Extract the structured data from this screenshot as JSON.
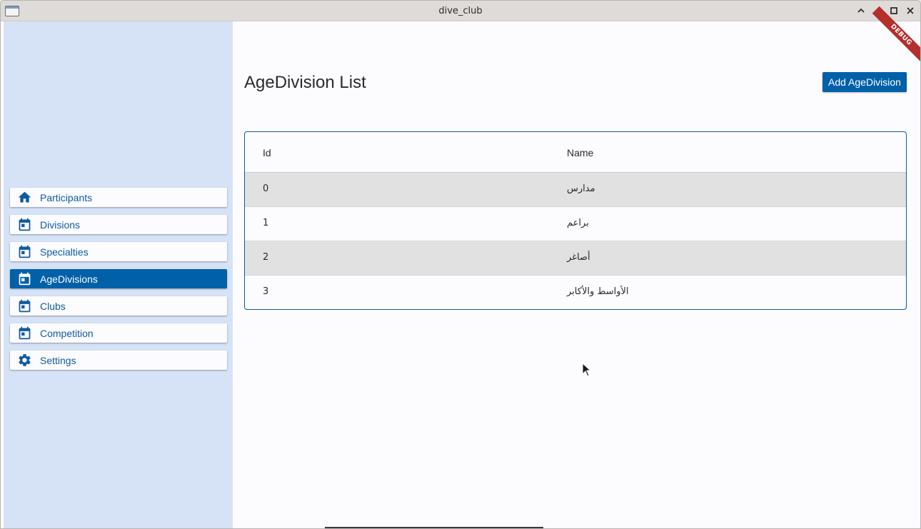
{
  "window": {
    "title": "dive_club"
  },
  "debug_banner": "DEBUG",
  "sidebar": {
    "items": [
      {
        "label": "Participants",
        "icon": "home-icon",
        "active": false
      },
      {
        "label": "Divisions",
        "icon": "calendar-icon",
        "active": false
      },
      {
        "label": "Specialties",
        "icon": "calendar-icon",
        "active": false
      },
      {
        "label": "AgeDivisions",
        "icon": "calendar-icon",
        "active": true
      },
      {
        "label": "Clubs",
        "icon": "calendar-icon",
        "active": false
      },
      {
        "label": "Competition",
        "icon": "calendar-icon",
        "active": false
      },
      {
        "label": "Settings",
        "icon": "gear-icon",
        "active": false
      }
    ]
  },
  "main": {
    "title": "AgeDivision List",
    "add_button": "Add AgeDivision",
    "table": {
      "columns": [
        "Id",
        "Name"
      ],
      "rows": [
        {
          "id": "0",
          "name": "مدارس"
        },
        {
          "id": "1",
          "name": "براعم"
        },
        {
          "id": "2",
          "name": "أصاغر"
        },
        {
          "id": "3",
          "name": "الأواسط والأكابر"
        }
      ]
    }
  },
  "colors": {
    "primary": "#0060a8",
    "sidebar_bg": "#d6e3f6",
    "row_shaded": "#e1e1e1",
    "debug": "#b3302c"
  }
}
